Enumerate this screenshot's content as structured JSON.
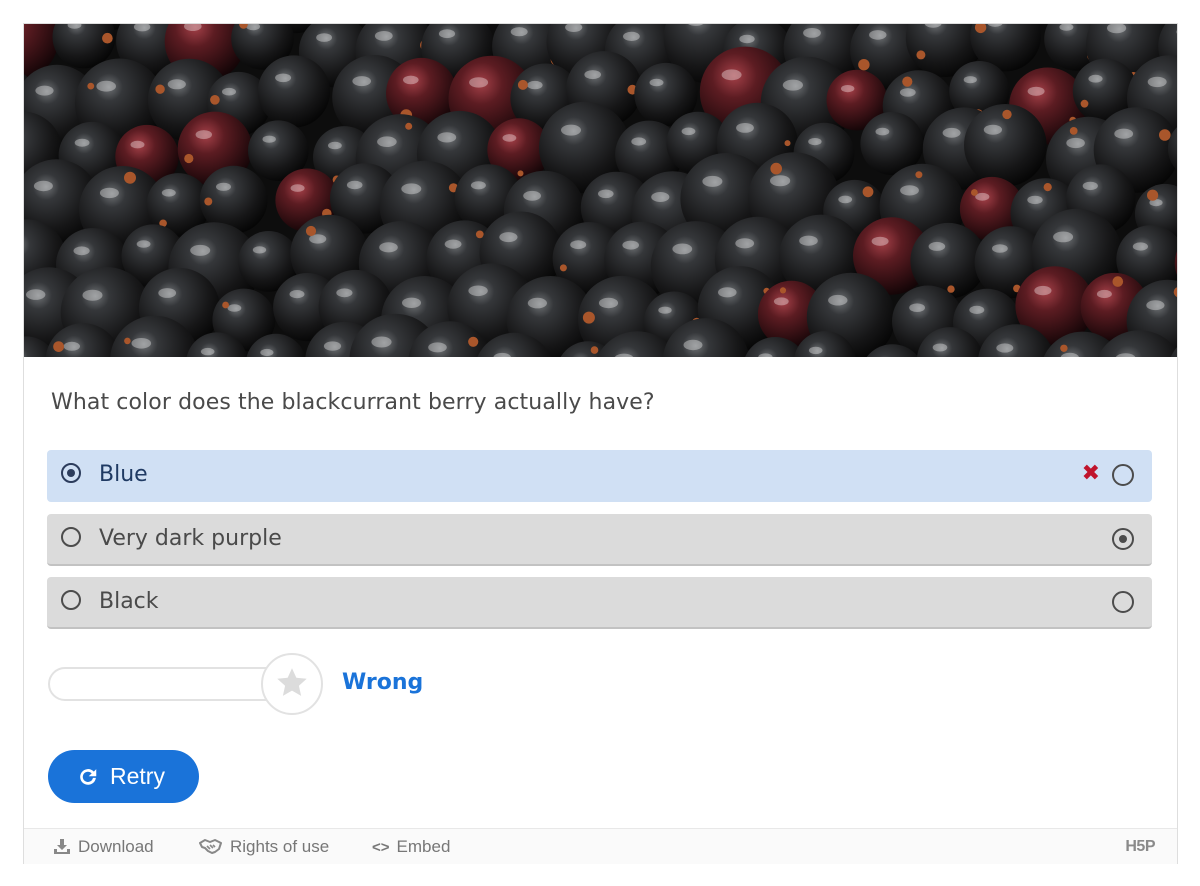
{
  "question": "What color does the blackcurrant berry actually have?",
  "options": [
    {
      "label": "Blue",
      "selected": true,
      "correct": false,
      "mark": "✖"
    },
    {
      "label": "Very dark purple",
      "selected": false,
      "correct": true
    },
    {
      "label": "Black",
      "selected": false,
      "correct": false
    }
  ],
  "score": {
    "earned": 0,
    "max": 1,
    "feedback": "Wrong"
  },
  "retry_label": "Retry",
  "footer": {
    "download": "Download",
    "rights": "Rights of use",
    "embed": "Embed",
    "logo": "H5P"
  },
  "colors": {
    "accent": "#1a73d9",
    "wrong": "#c0142c",
    "selected_bg": "#d0e0f4",
    "option_bg": "#dbdbdb"
  }
}
